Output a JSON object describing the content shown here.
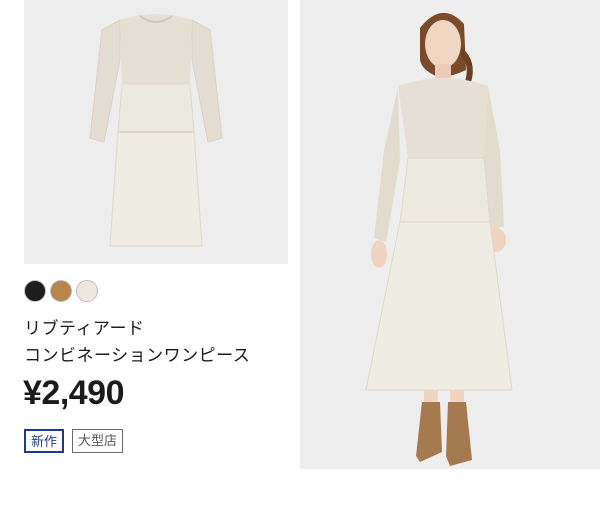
{
  "product": {
    "name_line1": "リブティアード",
    "name_line2": "コンビネーションワンピース",
    "price": "¥2,490",
    "swatches": [
      {
        "name": "black",
        "color": "#1d1d1d"
      },
      {
        "name": "brown",
        "color": "#b8864d"
      },
      {
        "name": "off-white",
        "color": "#ece8e1"
      }
    ],
    "tags": [
      {
        "label": "新作",
        "color": "#1e3a8a"
      },
      {
        "label": "大型店",
        "color": "#555555"
      }
    ]
  },
  "images": {
    "product_bg": "#ededed",
    "model_bg": "#eeeeee",
    "dress_top_color": "#e6e0d4",
    "dress_skirt_color": "#ece9df"
  }
}
